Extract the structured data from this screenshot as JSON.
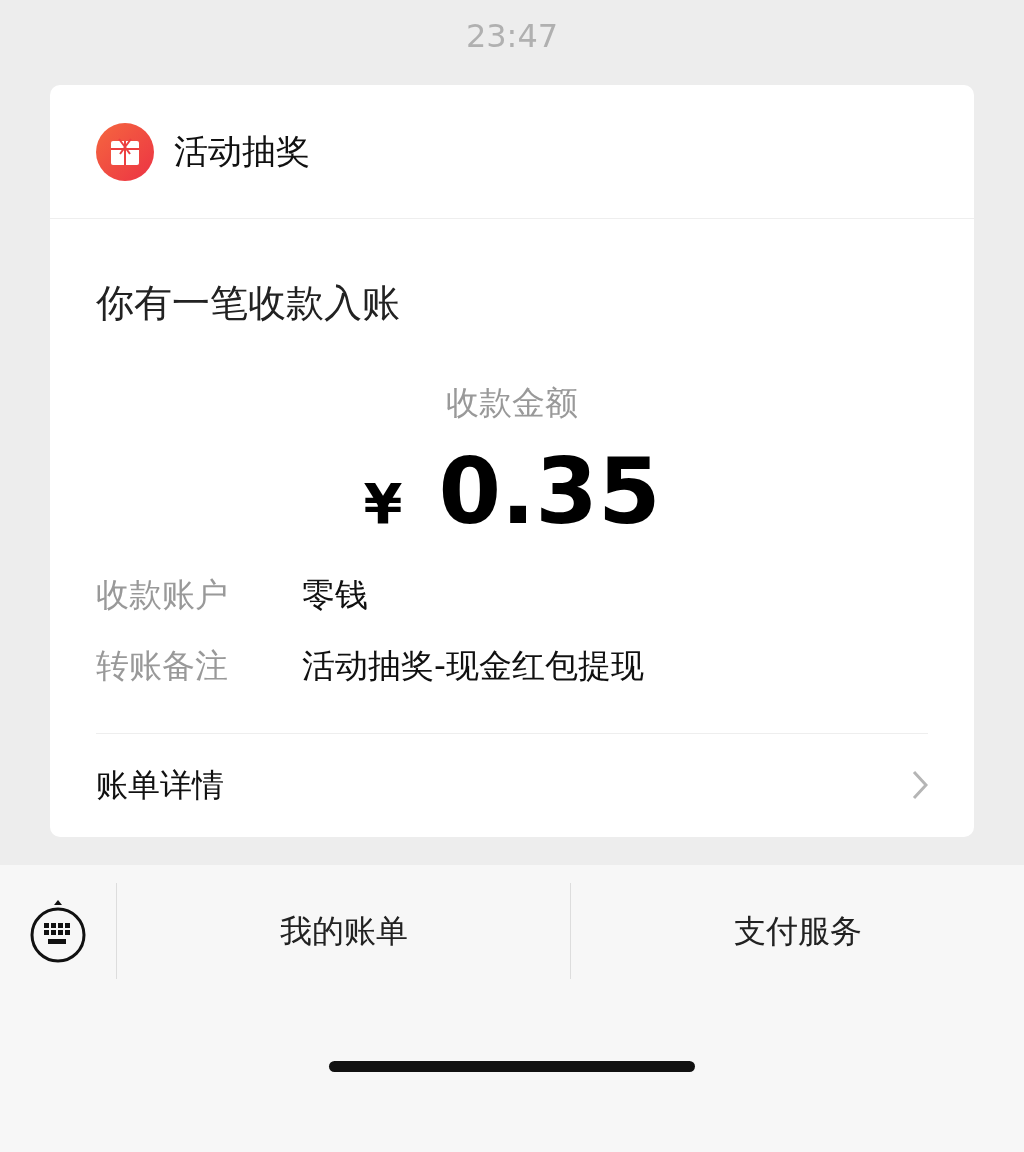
{
  "status_bar": {
    "time": "23:47"
  },
  "card": {
    "source": "活动抽奖",
    "title": "你有一笔收款入账",
    "amount_label": "收款金额",
    "currency": "¥",
    "amount": "0.35",
    "details": [
      {
        "label": "收款账户",
        "value": "零钱"
      },
      {
        "label": "转账备注",
        "value": "活动抽奖-现金红包提现"
      }
    ],
    "link": "账单详情"
  },
  "bottom_menu": [
    "我的账单",
    "支付服务"
  ]
}
